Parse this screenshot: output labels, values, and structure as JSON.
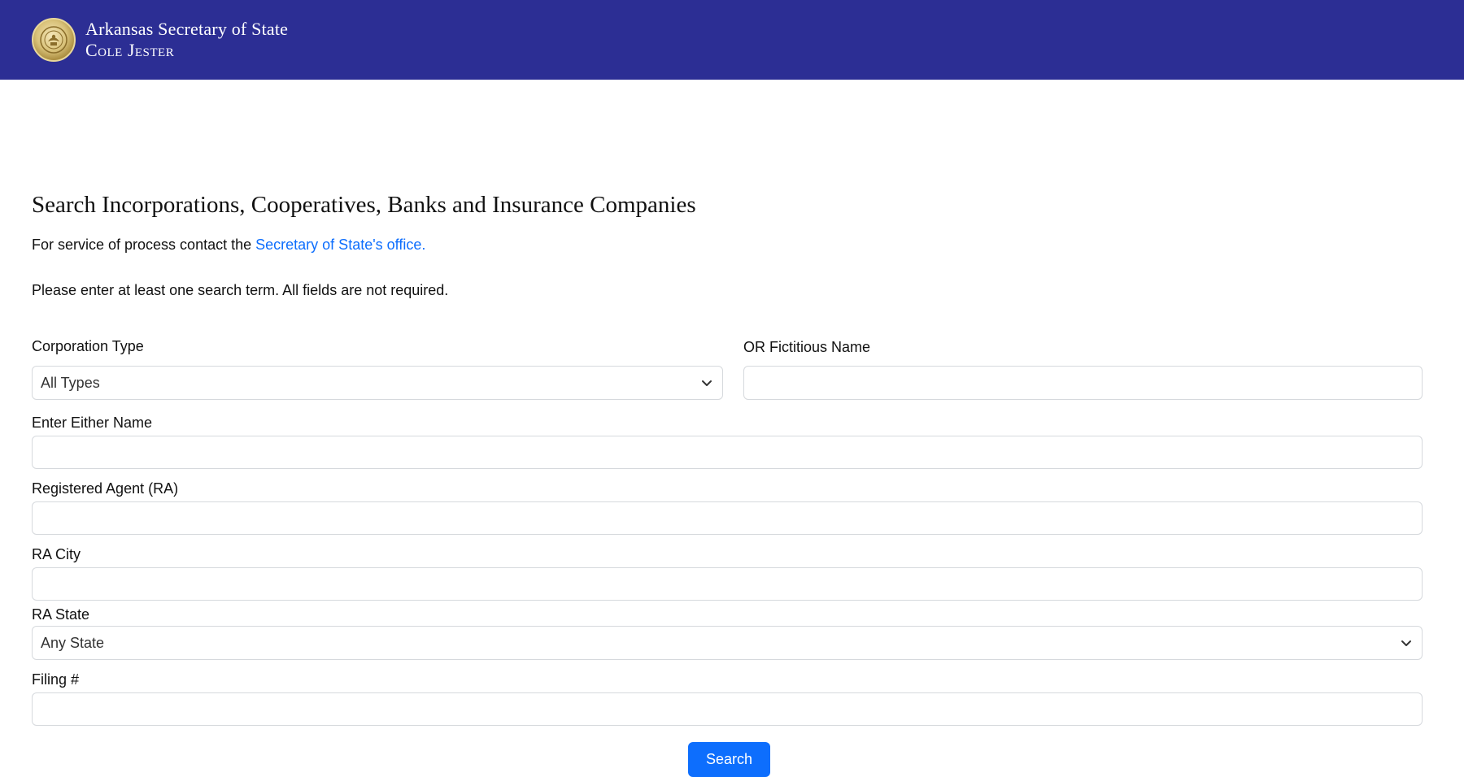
{
  "header": {
    "org_line1": "Arkansas Secretary of State",
    "org_line2": "Cole Jester",
    "seal_icon": "state-seal-icon"
  },
  "page": {
    "title": "Search Incorporations, Cooperatives, Banks and Insurance Companies",
    "service_prefix": "For service of process contact the",
    "service_link": "Secretary of State's office.",
    "instructions": "Please enter at least one search term. All fields are not required."
  },
  "form": {
    "corporation_type": {
      "label": "Corporation Type",
      "value": "All Types"
    },
    "fictitious_name": {
      "label": "OR Fictitious Name",
      "value": ""
    },
    "either_name": {
      "label": "Enter Either Name",
      "value": ""
    },
    "registered_agent": {
      "label": "Registered Agent (RA)",
      "value": ""
    },
    "ra_city": {
      "label": "RA City",
      "value": ""
    },
    "ra_state": {
      "label": "RA State",
      "value": "Any State"
    },
    "filing_number": {
      "label": "Filing #",
      "value": ""
    },
    "search_label": "Search"
  },
  "colors": {
    "header_bg": "#2c2e94",
    "link": "#0d6efd",
    "button": "#0d6efd"
  }
}
